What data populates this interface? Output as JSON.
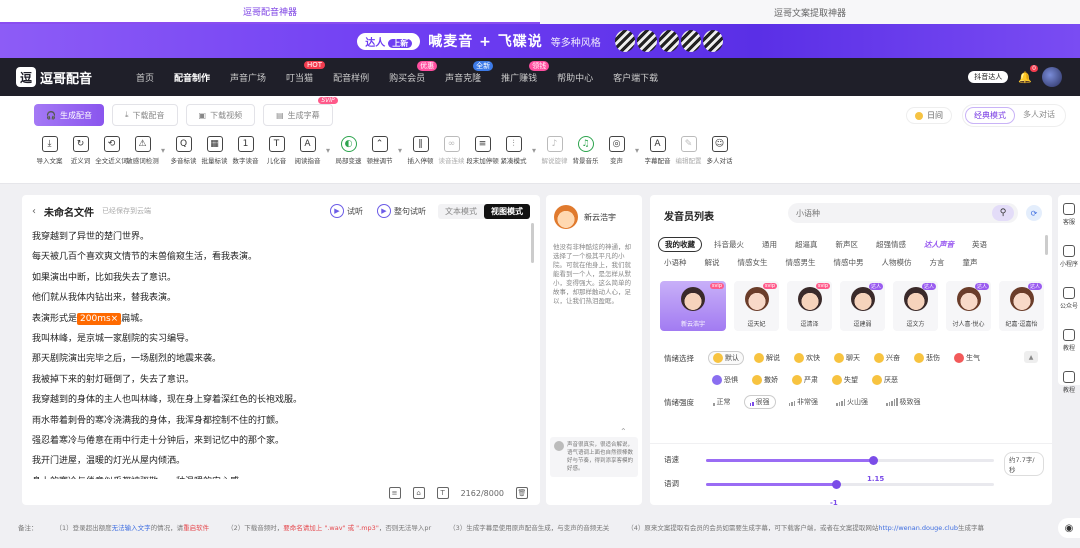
{
  "tabs": [
    {
      "label": "逗哥配音神器",
      "active": true
    },
    {
      "label": "逗哥文案提取神器",
      "active": false
    }
  ],
  "banner": {
    "pill_label": "达人",
    "pill_new": "上新",
    "headline": "喊麦音 + 飞碟说",
    "sub": "等多种风格"
  },
  "nav": {
    "logo_mark": "逗",
    "logo_name": "逗哥配音",
    "items": [
      {
        "label": "首页",
        "active": false,
        "badge": "",
        "badge_color": ""
      },
      {
        "label": "配音制作",
        "active": true,
        "badge": "",
        "badge_color": ""
      },
      {
        "label": "声音广场",
        "active": false,
        "badge": "",
        "badge_color": ""
      },
      {
        "label": "叮当猫",
        "active": false,
        "badge": "HOT",
        "badge_color": "#f23c4f"
      },
      {
        "label": "配音样例",
        "active": false,
        "badge": "",
        "badge_color": ""
      },
      {
        "label": "购买会员",
        "active": false,
        "badge": "优惠",
        "badge_color": "#ff4fa0"
      },
      {
        "label": "声音克隆",
        "active": false,
        "badge": "全新",
        "badge_color": "#3d7be8"
      },
      {
        "label": "推广赚钱",
        "active": false,
        "badge": "领钱",
        "badge_color": "#ff4fa0"
      },
      {
        "label": "帮助中心",
        "active": false,
        "badge": "",
        "badge_color": ""
      },
      {
        "label": "客户端下载",
        "active": false,
        "badge": "",
        "badge_color": ""
      }
    ],
    "tiktok_label": "抖音达人",
    "bell_count": "0"
  },
  "toolbar": {
    "buttons": [
      {
        "label": "生成配音",
        "primary": true,
        "svip": ""
      },
      {
        "label": "下载配音",
        "primary": false,
        "svip": ""
      },
      {
        "label": "下载视频",
        "primary": false,
        "svip": ""
      },
      {
        "label": "生成字幕",
        "primary": false,
        "svip": "SVIP"
      }
    ],
    "day_label": "日间",
    "modes": [
      {
        "label": "经典模式",
        "on": true
      },
      {
        "label": "多人对话",
        "on": false
      }
    ],
    "tools": [
      {
        "icon": "⤓",
        "label": "导入文案",
        "style": ""
      },
      {
        "icon": "↻",
        "label": "近义词",
        "style": ""
      },
      {
        "icon": "⟲",
        "label": "全文近义词",
        "style": ""
      },
      {
        "icon": "⚠",
        "label": "敏感词检测",
        "style": ""
      },
      {
        "sep": true
      },
      {
        "icon": "Q",
        "label": "多音标读",
        "style": ""
      },
      {
        "icon": "▦",
        "label": "批量标读",
        "style": ""
      },
      {
        "icon": "1",
        "label": "数字读音",
        "style": ""
      },
      {
        "icon": "T",
        "label": "儿化音",
        "style": ""
      },
      {
        "icon": "A",
        "label": "阅读指音",
        "style": ""
      },
      {
        "sep": true
      },
      {
        "icon": "◐",
        "label": "局部变速",
        "style": "green"
      },
      {
        "icon": "⌃",
        "label": "顿挫调节",
        "style": ""
      },
      {
        "sep": true
      },
      {
        "icon": "‖",
        "label": "插入停顿",
        "style": ""
      },
      {
        "icon": "∞",
        "label": "读音连续",
        "style": "gray"
      },
      {
        "icon": "≡",
        "label": "段末加停顿",
        "style": ""
      },
      {
        "icon": "⫶",
        "label": "紧凑模式",
        "style": ""
      },
      {
        "sep": true
      },
      {
        "icon": "♪",
        "label": "解说旋律",
        "style": "gray"
      },
      {
        "icon": "♫",
        "label": "背景音乐",
        "style": "green"
      },
      {
        "icon": "◎",
        "label": "变声",
        "style": ""
      },
      {
        "sep": true
      },
      {
        "icon": "A",
        "label": "字幕配音",
        "style": ""
      },
      {
        "icon": "✎",
        "label": "编辑配置",
        "style": "gray"
      },
      {
        "icon": "☺",
        "label": "多人对话",
        "style": ""
      }
    ]
  },
  "editor": {
    "title": "未命名文件",
    "saved": "已经保存到云端",
    "listen": "试听",
    "segment_listen": "整句试听",
    "mode_text": "文本模式",
    "mode_view": "视图模式",
    "lines": [
      "我穿越到了异世的楚门世界。",
      "每天被几百个喜欢爽文情节的末兽偷窥生活，看我表演。",
      "如果演出中断，比如我失去了意识。",
      "他们就从我体内钻出来，替我表演。",
      "表演形式是",
      "我叫林峰，是京城一家剧院的实习编导。",
      "那天剧院演出完毕之后，一场剧烈的地震来袭。",
      "我被掉下来的射灯砸倒了，失去了意识。",
      "我穿越到的身体的主人也叫林峰，现在身上穿着深红色的长袍戏服。",
      "雨水带着刺骨的寒冷浇满我的身体，我浑身都控制不住的打颤。",
      "强忍着寒冷与倦意在雨中行走十分钟后，来到记忆中的那个家。",
      "我开门进屋，温暖的灯光从屋内倾洒。",
      "身上的寒冷与倦意似乎都被驱散，一种温暖的安心感"
    ],
    "pause_tag": "200ms×",
    "pause_suffix": "扁城。",
    "char_count": "2162/8000"
  },
  "speaker": {
    "name": "新云浩宇",
    "desc": "他没有非种酷炫的神通，却选择了一个极其平凡的小院。可就在他身上，我们就能看到一个人，是怎样从默小，变得强大。这么简单的故事，却那样触动人心，足以，让我们热泪盈眶。",
    "msg": "声音很真实，很适合解说，语气语调上面也自然很棒数好与节奏，得到添享客模的好感。"
  },
  "voices": {
    "title": "发音员列表",
    "search_placeholder": "小语种",
    "cat_rows": [
      [
        {
          "label": "我的收藏",
          "on": true,
          "tag": false
        },
        {
          "label": "抖音最火",
          "on": false,
          "tag": false
        },
        {
          "label": "通用",
          "on": false,
          "tag": false
        },
        {
          "label": "超逼真",
          "on": false,
          "tag": false
        },
        {
          "label": "新声区",
          "on": false,
          "tag": false
        },
        {
          "label": "超强情感",
          "on": false,
          "tag": false
        },
        {
          "label": "达人声音",
          "on": false,
          "tag": true
        },
        {
          "label": "英语",
          "on": false,
          "tag": false
        }
      ],
      [
        {
          "label": "小语种",
          "on": false,
          "tag": false
        },
        {
          "label": "解说",
          "on": false,
          "tag": false
        },
        {
          "label": "情感女生",
          "on": false,
          "tag": false
        },
        {
          "label": "情感男生",
          "on": false,
          "tag": false
        },
        {
          "label": "情感中男",
          "on": false,
          "tag": false
        },
        {
          "label": "人物模仿",
          "on": false,
          "tag": false
        },
        {
          "label": "方言",
          "on": false,
          "tag": false
        },
        {
          "label": "童声",
          "on": false,
          "tag": false
        }
      ]
    ],
    "cards": [
      {
        "name": "新云浩宇",
        "tag": "svip",
        "tag_label": "svip",
        "first": true,
        "female": false
      },
      {
        "name": "逗天妃",
        "tag": "svip",
        "tag_label": "svip",
        "first": false,
        "female": true
      },
      {
        "name": "逗清泽",
        "tag": "svip",
        "tag_label": "svip",
        "first": false,
        "female": false
      },
      {
        "name": "逗建弱",
        "tag": "daren",
        "tag_label": "达人",
        "first": false,
        "female": false
      },
      {
        "name": "逗文方",
        "tag": "daren",
        "tag_label": "达人",
        "first": false,
        "female": false
      },
      {
        "name": "讨人喜·悦心",
        "tag": "daren",
        "tag_label": "达人",
        "first": false,
        "female": true
      },
      {
        "name": "纪嘉·逗嘉怡",
        "tag": "daren",
        "tag_label": "达人",
        "first": false,
        "female": true
      }
    ],
    "emotion_label": "情绪选择",
    "emotions_row1": [
      {
        "label": "默认",
        "on": true,
        "color": ""
      },
      {
        "label": "解说",
        "on": false,
        "color": ""
      },
      {
        "label": "欢快",
        "on": false,
        "color": ""
      },
      {
        "label": "聊天",
        "on": false,
        "color": ""
      },
      {
        "label": "兴奋",
        "on": false,
        "color": ""
      },
      {
        "label": "悲伤",
        "on": false,
        "color": ""
      },
      {
        "label": "生气",
        "on": false,
        "color": "red"
      }
    ],
    "emotions_row2": [
      {
        "label": "恐惧",
        "on": false,
        "color": "purple"
      },
      {
        "label": "撒娇",
        "on": false,
        "color": ""
      },
      {
        "label": "严肃",
        "on": false,
        "color": ""
      },
      {
        "label": "失望",
        "on": false,
        "color": ""
      },
      {
        "label": "厌恶",
        "on": false,
        "color": ""
      }
    ],
    "intensity_label": "情绪强度",
    "intensities": [
      {
        "label": "正常",
        "on": false,
        "bars": 1
      },
      {
        "label": "很强",
        "on": true,
        "bars": 2
      },
      {
        "label": "非常强",
        "on": false,
        "bars": 3
      },
      {
        "label": "火山强",
        "on": false,
        "bars": 4
      },
      {
        "label": "极致强",
        "on": false,
        "bars": 5
      }
    ],
    "speed_label": "语速",
    "speed_value": "1.15",
    "speed_fraction": 0.58,
    "speed_unit": "约7.7字/秒",
    "pitch_label": "语调",
    "pitch_value": "-1",
    "pitch_fraction": 0.45
  },
  "edge": [
    {
      "label": "客服"
    },
    {
      "label": "小程序"
    },
    {
      "label": "公众号"
    },
    {
      "label": "教程"
    },
    {
      "label": "教程"
    }
  ],
  "notes": {
    "n0": "备注：",
    "n1a": "（1）登录超出额度",
    "n1b": "无法输入文字",
    "n1c": "的情况，请",
    "n1d": "重启软件",
    "n2a": "（2）下载音频时，",
    "n2b": "要命名请加上 \".wav\" 或 \".mp3\"",
    "n2c": "，否则无法导入pr",
    "n3": "（3）生成字幕是使用原声配音生成，与变声的音频无关",
    "n4a": "（4）原来文案提取有会员的会员如需要生成字幕，可下载客户端，或者在文案提取网站",
    "n4b": "http://wenan.douge.club",
    "n4c": "生成字幕"
  }
}
